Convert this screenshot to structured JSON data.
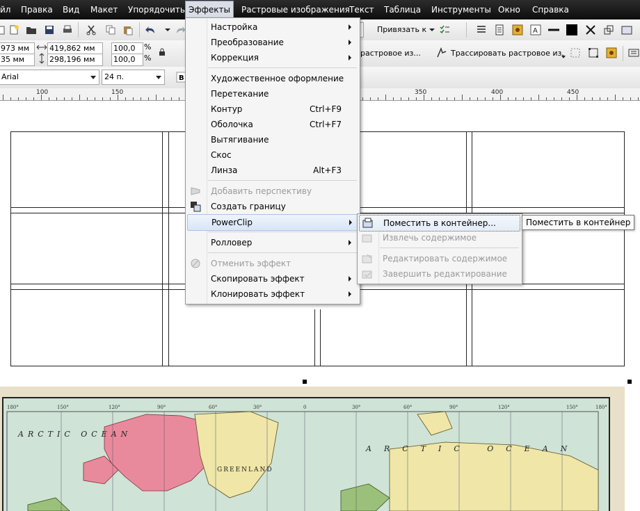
{
  "menubar": {
    "items": [
      "йл",
      "Правка",
      "Вид",
      "Макет",
      "Упорядочить",
      "Эффекты",
      "Растровые изображения",
      "Текст",
      "Таблица",
      "Инструменты",
      "Окно",
      "Справка"
    ],
    "active_index": 5
  },
  "toolbar": {
    "snap_label": "Привязать к",
    "trace_label_partial": "ь растровое из...",
    "trace_label": "Трассировать растровое из.",
    "width_partial": "973 мм",
    "height_partial": "35 мм",
    "x_value": "419,862 мм",
    "y_value": "298,196 мм",
    "scale_x": "100,0",
    "scale_y": "100,0",
    "pct": "%",
    "font_name": "Arial",
    "font_size": "24 п."
  },
  "ruler": {
    "labels": [
      "100",
      "150",
      "350",
      "400",
      "450"
    ]
  },
  "effects_menu": {
    "items": [
      {
        "label": "Настройка",
        "shortcut": "",
        "submenu": true,
        "disabled": false
      },
      {
        "label": "Преобразование",
        "shortcut": "",
        "submenu": true,
        "disabled": false
      },
      {
        "label": "Коррекция",
        "shortcut": "",
        "submenu": true,
        "disabled": false
      },
      {
        "label": "Художественное оформление",
        "shortcut": "",
        "submenu": false,
        "disabled": false
      },
      {
        "label": "Перетекание",
        "shortcut": "",
        "submenu": false,
        "disabled": false
      },
      {
        "label": "Контур",
        "shortcut": "Ctrl+F9",
        "submenu": false,
        "disabled": false
      },
      {
        "label": "Оболочка",
        "shortcut": "Ctrl+F7",
        "submenu": false,
        "disabled": false
      },
      {
        "label": "Вытягивание",
        "shortcut": "",
        "submenu": false,
        "disabled": false
      },
      {
        "label": "Скос",
        "shortcut": "",
        "submenu": false,
        "disabled": false
      },
      {
        "label": "Линза",
        "shortcut": "Alt+F3",
        "submenu": false,
        "disabled": false
      },
      {
        "label": "Добавить перспективу",
        "shortcut": "",
        "submenu": false,
        "disabled": true
      },
      {
        "label": "Создать границу",
        "shortcut": "",
        "submenu": false,
        "disabled": false
      },
      {
        "label": "PowerClip",
        "shortcut": "",
        "submenu": true,
        "disabled": false
      },
      {
        "label": "Ролловер",
        "shortcut": "",
        "submenu": true,
        "disabled": false
      },
      {
        "label": "Отменить эффект",
        "shortcut": "",
        "submenu": false,
        "disabled": true
      },
      {
        "label": "Скопировать эффект",
        "shortcut": "",
        "submenu": true,
        "disabled": false
      },
      {
        "label": "Клонировать эффект",
        "shortcut": "",
        "submenu": true,
        "disabled": false
      }
    ]
  },
  "powerclip_menu": {
    "items": [
      {
        "label": "Поместить в контейнер...",
        "disabled": false
      },
      {
        "label": "Извлечь содержимое",
        "disabled": true
      },
      {
        "label": "Редактировать содержимое",
        "disabled": true
      },
      {
        "label": "Завершить редактирование",
        "disabled": true
      }
    ]
  },
  "tooltip": "Поместить в контейнер",
  "map": {
    "arctic_left": "ARCTIC OCEAN",
    "arctic_right": "ARCTIC OCEAN",
    "greenland": "GREENLAND",
    "degrees": [
      "180°",
      "150°",
      "120°",
      "90°",
      "60°",
      "30°",
      "0",
      "30°",
      "60°",
      "90°",
      "120°",
      "150°",
      "180°"
    ]
  },
  "colors": {
    "menubar_bg": "#1a1a1a",
    "menu_bg": "#f5f5f5",
    "highlight": "#d9e6f6",
    "map_ocean": "#cfe3d6",
    "map_land_pink": "#e98a9c",
    "map_land_yellow": "#efe6a8"
  }
}
